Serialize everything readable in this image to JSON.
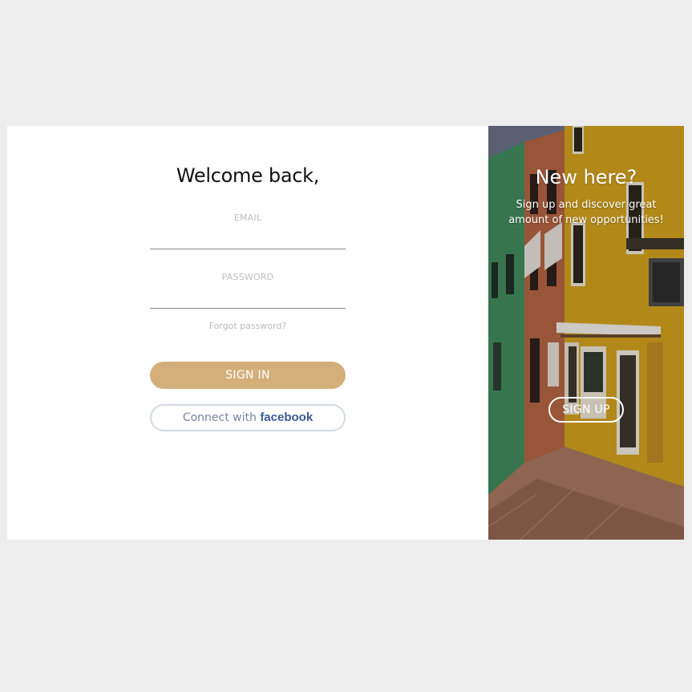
{
  "signin": {
    "title": "Welcome back,",
    "email_label": "EMAIL",
    "email_value": "",
    "password_label": "PASSWORD",
    "password_value": "",
    "forgot_link": "Forgot password?",
    "signin_button": "SIGN IN",
    "facebook_prefix": "Connect with",
    "facebook_brand": "facebook"
  },
  "signup_panel": {
    "title": "New here?",
    "text": "Sign up and discover great amount of new opportunities!",
    "signup_button": "SIGN UP"
  },
  "colors": {
    "page_background": "#ededed",
    "accent": "#d4af7a",
    "facebook_blue": "#3b5a96"
  }
}
